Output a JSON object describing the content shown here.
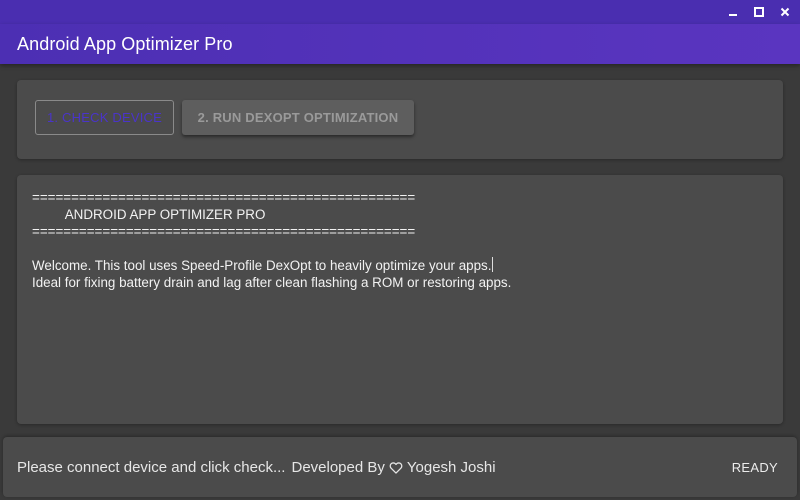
{
  "app": {
    "title": "Android App Optimizer Pro"
  },
  "window_controls": {
    "minimize_icon": "minimize-icon",
    "maximize_icon": "maximize-icon",
    "close_icon": "close-icon"
  },
  "toolbar": {
    "check_device_label": "1. CHECK DEVICE",
    "run_dexopt_label": "2. RUN DEXOPT OPTIMIZATION"
  },
  "console": {
    "lines": [
      "=================================================",
      "         ANDROID APP OPTIMIZER PRO",
      "=================================================",
      "",
      "Welcome. This tool uses Speed-Profile DexOpt to heavily optimize your apps.",
      "Ideal for fixing battery drain and lag after clean flashing a ROM or restoring apps."
    ]
  },
  "status": {
    "message": "Please connect device and click check...",
    "developed_by": "Developed By",
    "developer_name": "Yogesh Joshi",
    "heart_icon": "heart-outline-icon",
    "state": "READY"
  },
  "colors": {
    "accent": "#4c2fb3",
    "titlebar": "#4a2eb0",
    "background": "#3a3a3a",
    "card": "#4b4b4b",
    "check_button_text": "#4a34c9",
    "disabled_button_text": "#9a9a9a"
  }
}
